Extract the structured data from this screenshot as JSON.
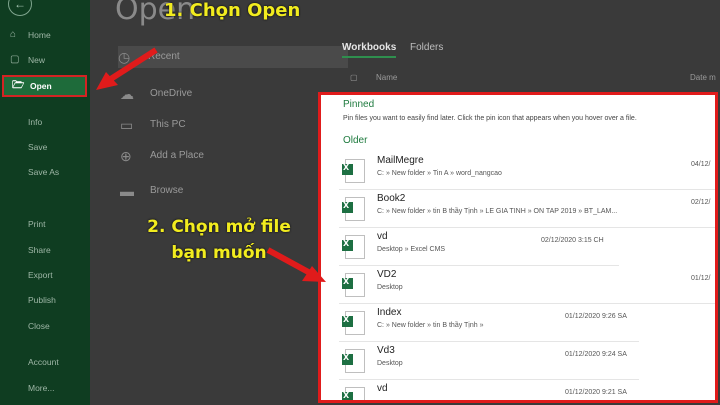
{
  "sidebar": {
    "items": [
      {
        "label": "Home",
        "icon": "home-icon"
      },
      {
        "label": "New",
        "icon": "new-file-icon"
      },
      {
        "label": "Open",
        "icon": "folder-open-icon"
      },
      {
        "label": "Info"
      },
      {
        "label": "Save"
      },
      {
        "label": "Save As"
      },
      {
        "label": "Print"
      },
      {
        "label": "Share"
      },
      {
        "label": "Export"
      },
      {
        "label": "Publish"
      },
      {
        "label": "Close"
      },
      {
        "label": "Account"
      },
      {
        "label": "More..."
      }
    ]
  },
  "page_title": "Open",
  "locations": [
    {
      "label": "Recent",
      "icon": "clock-icon"
    },
    {
      "label": "OneDrive",
      "icon": "cloud-icon"
    },
    {
      "label": "This PC",
      "icon": "computer-icon"
    },
    {
      "label": "Add a Place",
      "icon": "globe-icon"
    },
    {
      "label": "Browse",
      "icon": "folder-icon"
    }
  ],
  "tabs": [
    {
      "label": "Workbooks",
      "active": true
    },
    {
      "label": "Folders",
      "active": false
    }
  ],
  "list_headers": {
    "name": "Name",
    "date": "Date m"
  },
  "panel": {
    "pinned_title": "Pinned",
    "pinned_hint": "Pin files you want to easily find later. Click the pin icon that appears when you hover over a file.",
    "older_title": "Older",
    "files": [
      {
        "name": "MailMegre",
        "path": "C: » New folder » Tin A » word_nangcao",
        "date": "04/12/"
      },
      {
        "name": "Book2",
        "path": "C: » New folder » tin B thầy Tịnh » LE GIA TINH » ON TAP 2019 » BT_LAM...",
        "date": "02/12/"
      },
      {
        "name": "vd",
        "path": "Desktop » Excel CMS",
        "date": "02/12/2020 3:15 CH"
      },
      {
        "name": "VD2",
        "path": "Desktop",
        "date": "01/12/"
      },
      {
        "name": "Index",
        "path": "C: » New folder » tin B thầy Tịnh »",
        "date": "01/12/2020 9:26 SA"
      },
      {
        "name": "Vd3",
        "path": "Desktop",
        "date": "01/12/2020 9:24 SA"
      },
      {
        "name": "vd",
        "path": "",
        "date": "01/12/2020 9:21 SA"
      }
    ]
  },
  "callouts": {
    "step1": "1. Chọn Open",
    "step2": "2. Chọn mở file bạn muốn"
  },
  "colors": {
    "excel_green": "#1d6f42",
    "accent_red": "#e01b1b",
    "callout_yellow": "#f2ec1f"
  }
}
